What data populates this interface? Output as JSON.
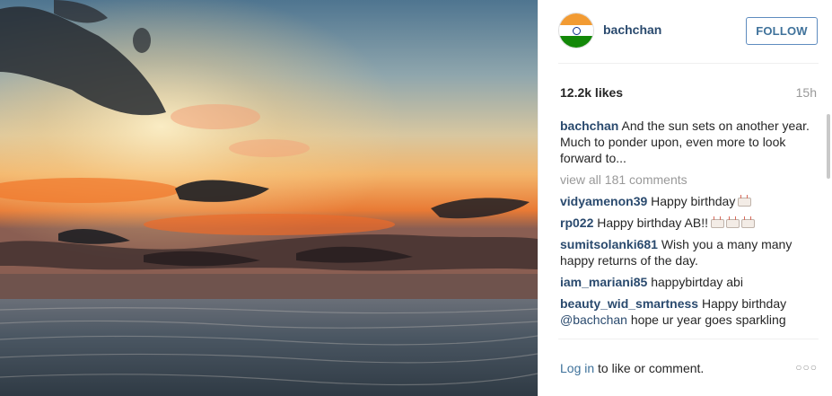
{
  "post": {
    "username": "bachchan",
    "follow_label": "FOLLOW",
    "likes": "12.2k likes",
    "time": "15h"
  },
  "caption": {
    "user": "bachchan",
    "text": "And the sun sets on another year. Much to ponder upon, even more to look forward to..."
  },
  "view_all": "view all 181 comments",
  "comments": [
    {
      "user": "vidyamenon39",
      "text": "Happy birthday",
      "cakes": 1
    },
    {
      "user": "rp022",
      "text": "Happy birthday AB!!",
      "cakes": 3
    },
    {
      "user": "sumitsolanki681",
      "text": "Wish you a many many happy returns of the day."
    },
    {
      "user": "iam_mariani85",
      "text": "happybirtday abi"
    },
    {
      "user": "beauty_wid_smartness",
      "text": "Happy birthday",
      "mention": "@bachchan",
      "text2": "hope ur year goes sparkling"
    }
  ],
  "footer": {
    "login_label": "Log in",
    "rest": "to like or comment.",
    "more": "○○○"
  },
  "photo": {
    "subject": "sunset over the sea",
    "colors": {
      "sky_top": "#5d86a3",
      "glow": "#f08a38",
      "sea": "#4a5660"
    }
  }
}
